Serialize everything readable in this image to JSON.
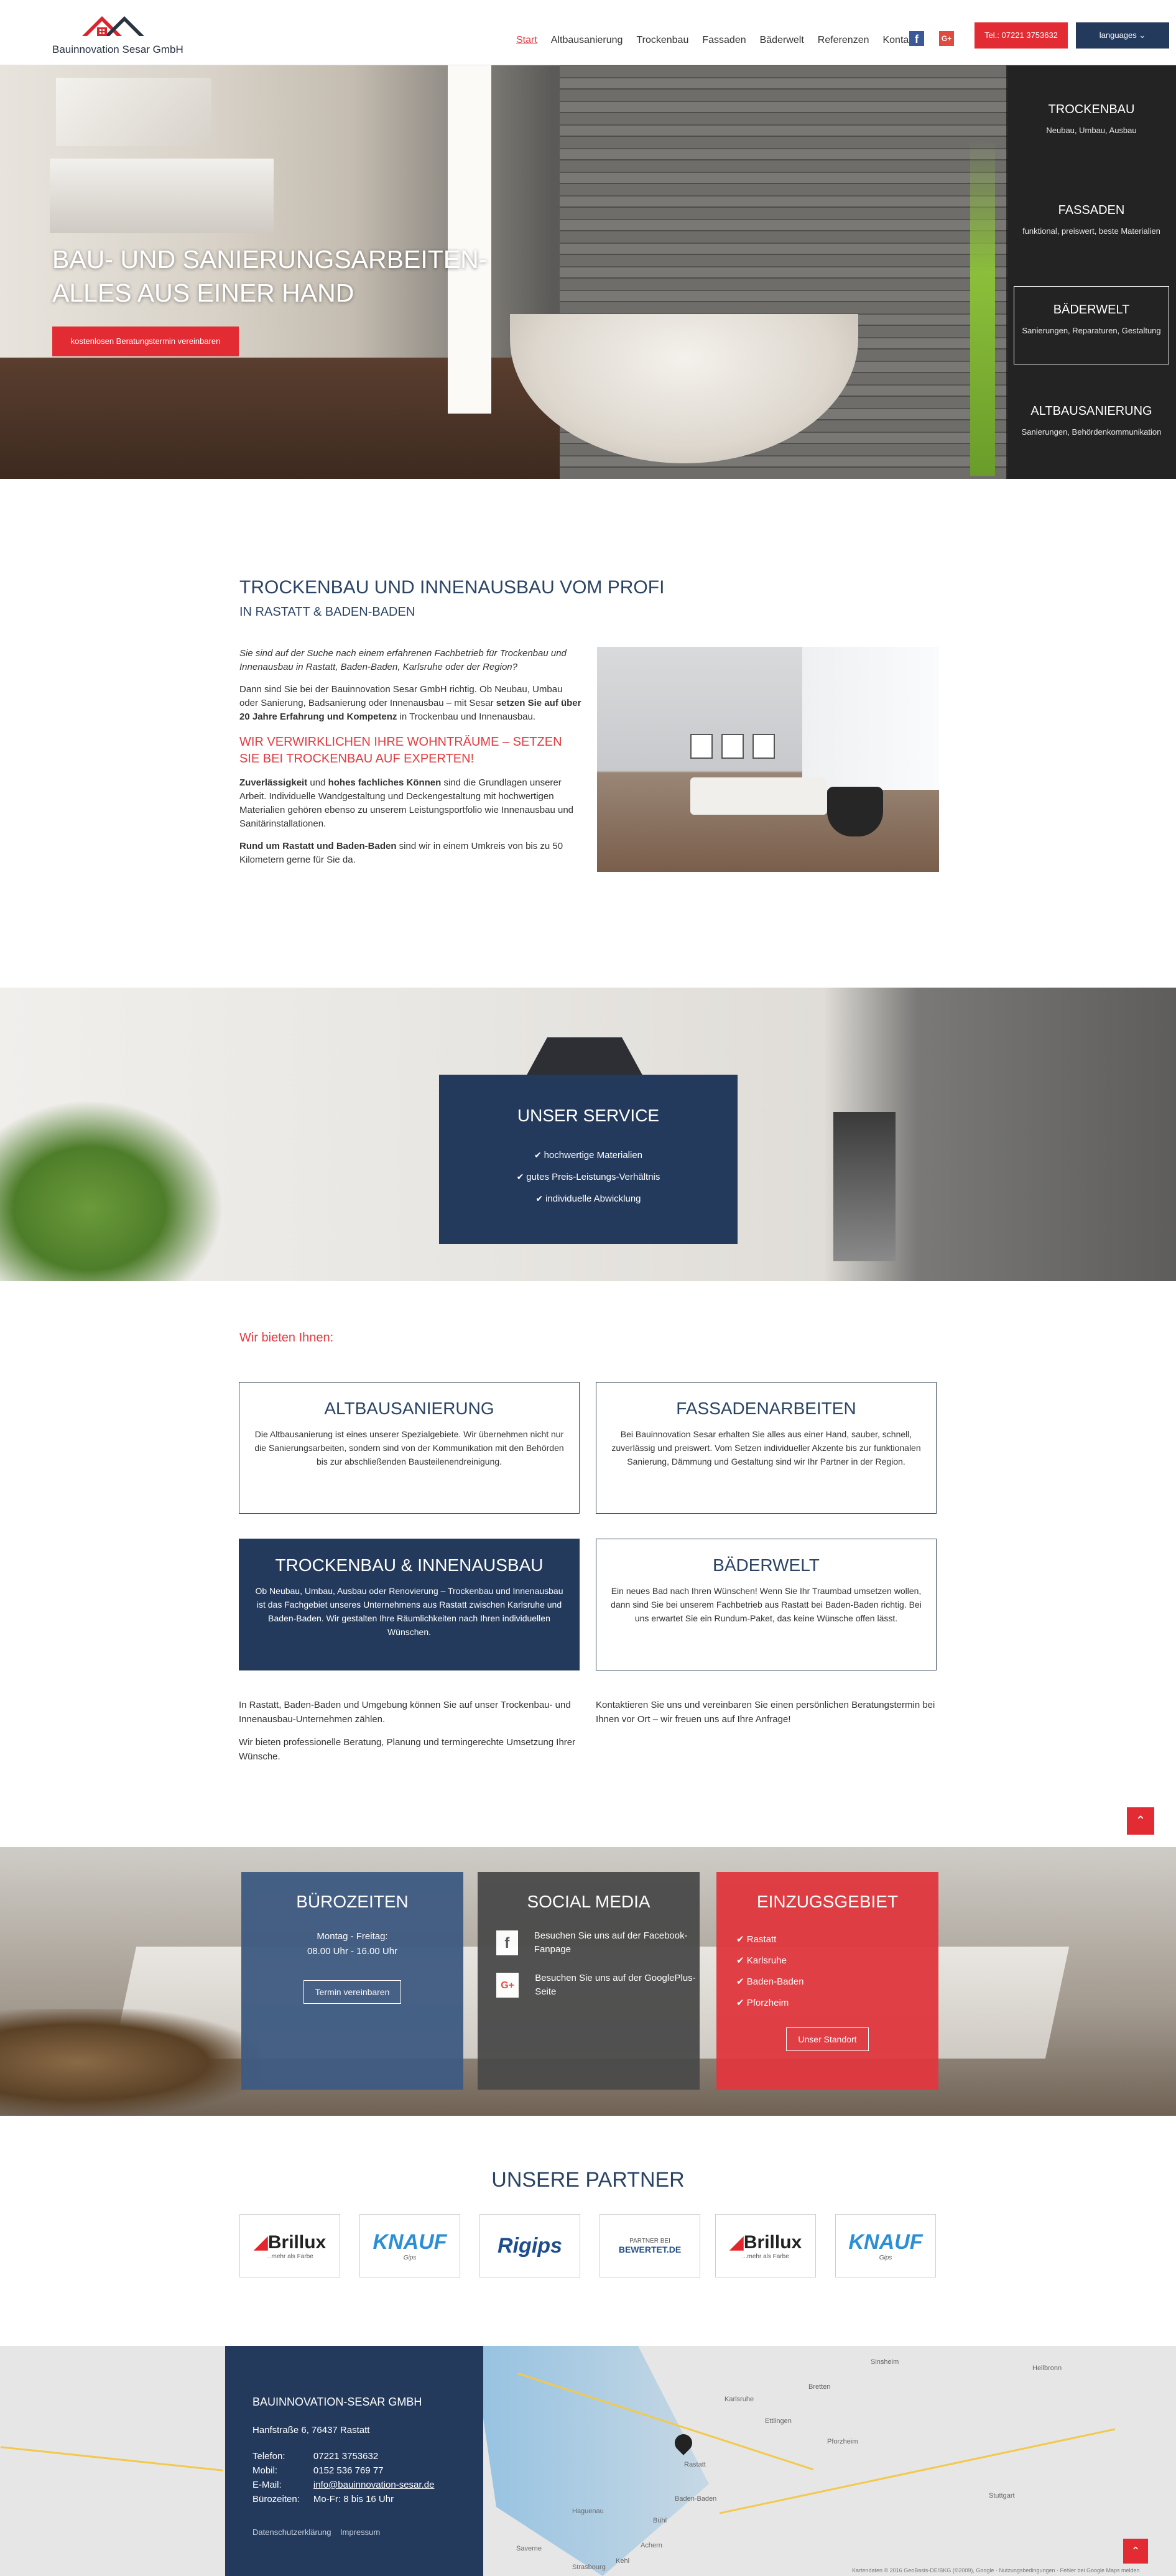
{
  "header": {
    "logo_text": "Bauinnovation Sesar GmbH",
    "nav": [
      "Start",
      "Altbausanierung",
      "Trockenbau",
      "Fassaden",
      "Bäderwelt",
      "Referenzen",
      "Kontakt"
    ],
    "phone_button": "Tel.: 07221 3753632",
    "language_button": "languages"
  },
  "hero": {
    "title_line1": "BAU- UND SANIERUNGSARBEITEN-",
    "title_line2": "ALLES AUS EINER HAND",
    "cta": "kostenlosen Beratungstermin vereinbaren"
  },
  "side_menu": [
    {
      "title": "TROCKENBAU",
      "desc": "Neubau, Umbau, Ausbau"
    },
    {
      "title": "FASSADEN",
      "desc": "funktional, preiswert, beste Materialien"
    },
    {
      "title": "BÄDERWELT",
      "desc": "Sanierungen, Reparaturen, Gestaltung"
    },
    {
      "title": "ALTBAUSANIERUNG",
      "desc": "Sanierungen, Behördenkommunikation"
    }
  ],
  "intro": {
    "heading": "TROCKENBAU UND INNENAUSBAU VOM PROFI",
    "subheading": "IN RASTATT & BADEN-BADEN",
    "p1": "Sie sind auf der Suche nach einem erfahrenen Fachbetrieb für Trockenbau und Innenausbau in Rastatt, Baden-Baden, Karlsruhe oder der Region?",
    "p2_a": "Dann sind Sie bei der Bauinnovation Sesar GmbH richtig. Ob Neubau, Umbau oder Sanierung, Badsanierung oder Innenausbau – mit Sesar ",
    "p2_b": "setzen Sie auf über 20 Jahre Erfahrung und Kompetenz",
    "p2_c": " in Trockenbau und Innenausbau.",
    "red_heading": "WIR VERWIRKLICHEN IHRE WOHNTRÄUME – SETZEN SIE BEI TROCKENBAU AUF EXPERTEN!",
    "p3_a": "Zuverlässigkeit",
    "p3_b": " und ",
    "p3_c": "hohes fachliches Können",
    "p3_d": " sind die Grundlagen unserer Arbeit. Individuelle Wandgestaltung und Deckengestaltung mit hochwertigen Materialien gehören ebenso zu unserem Leistungsportfolio wie Innenausbau und Sanitärinstallationen.",
    "p4_a": "Rund um Rastatt und Baden-Baden",
    "p4_b": " sind wir in einem Umkreis von bis zu 50 Kilometern gerne für Sie da."
  },
  "service": {
    "title": "UNSER SERVICE",
    "items": [
      "hochwertige Materialien",
      "gutes Preis-Leistungs-Verhältnis",
      "individuelle Abwicklung"
    ]
  },
  "offer": {
    "title": "Wir bieten Ihnen:",
    "cards": [
      {
        "title": "ALTBAUSANIERUNG",
        "text": "Die Altbausanierung ist eines unserer Spezialgebiete. Wir übernehmen nicht nur die Sanierungsarbeiten, sondern sind von der Kommunikation mit den Behörden bis zur abschließenden Bausteilenendreinigung."
      },
      {
        "title": "FASSADENARBEITEN",
        "text": "Bei Bauinnovation Sesar erhalten Sie alles aus einer Hand, sauber, schnell, zuverlässig und preiswert. Vom Setzen individueller Akzente bis zur funktionalen Sanierung, Dämmung und Gestaltung sind wir Ihr Partner in der Region."
      },
      {
        "title": "TROCKENBAU & INNENAUSBAU",
        "text": "Ob Neubau, Umbau, Ausbau oder Renovierung – Trockenbau und Innenausbau ist das Fachgebiet unseres Unternehmens aus Rastatt zwischen Karlsruhe und Baden-Baden. Wir gestalten Ihre Räumlichkeiten nach Ihren individuellen Wünschen."
      },
      {
        "title": "BÄDERWELT",
        "text": "Ein neues Bad nach Ihren Wünschen! Wenn Sie Ihr Traumbad umsetzen wollen, dann sind Sie bei unserem Fachbetrieb aus Rastatt bei Baden-Baden richtig. Bei uns erwartet Sie ein Rundum-Paket, das keine Wünsche offen lässt."
      }
    ],
    "note_left_1": "In Rastatt, Baden-Baden und Umgebung können Sie auf unser Trockenbau- und Innenausbau-Unternehmen zählen.",
    "note_left_2": "Wir bieten professionelle Beratung, Planung und termingerechte Umsetzung Ihrer Wünsche.",
    "note_right": "Kontaktieren Sie uns und vereinbaren Sie einen persönlichen Beratungstermin bei Ihnen vor Ort – wir freuen uns auf Ihre Anfrage!"
  },
  "info": {
    "hours_title": "BÜROZEITEN",
    "hours_days": "Montag - Freitag:",
    "hours_time": "08.00 Uhr - 16.00 Uhr",
    "hours_button": "Termin vereinbaren",
    "social_title": "SOCIAL MEDIA",
    "social_fb": "Besuchen Sie uns auf der Facebook-Fanpage",
    "social_gp": "Besuchen Sie uns auf der GooglePlus-Seite",
    "area_title": "EINZUGSGEBIET",
    "areas": [
      "Rastatt",
      "Karlsruhe",
      "Baden-Baden",
      "Pforzheim"
    ],
    "area_button": "Unser Standort",
    "colors": {
      "hours": "#3e5a82",
      "social": "#4a4a4a",
      "area": "#e0373e"
    }
  },
  "partners": {
    "title": "UNSERE PARTNER",
    "logos": [
      {
        "name": "Brillux",
        "sub": "...mehr als Farbe"
      },
      {
        "name": "KNAUF",
        "sub": "Gips"
      },
      {
        "name": "Rigips",
        "sub": ""
      },
      {
        "name": "BEWERTET.DE",
        "sub": "PARTNER BEI"
      },
      {
        "name": "Brillux",
        "sub": "...mehr als Farbe"
      },
      {
        "name": "KNAUF",
        "sub": "Gips"
      }
    ]
  },
  "contact": {
    "title": "BAUINNOVATION-SESAR GMBH",
    "address": "Hanfstraße 6, 76437 Rastatt",
    "rows": [
      {
        "label": "Telefon:",
        "value": "07221 3753632"
      },
      {
        "label": "Mobil:",
        "value": "0152 536 769 77"
      },
      {
        "label": "E-Mail:",
        "value": "info@bauinnovation-sesar.de"
      },
      {
        "label": "Bürozeiten:",
        "value": "Mo-Fr: 8 bis 16 Uhr"
      }
    ],
    "privacy": "Datenschutzerklärung",
    "imprint": "Impressum"
  },
  "map": {
    "cities": [
      "Haguenau",
      "Karlsruhe",
      "Rastatt",
      "Baden-Baden",
      "Pforzheim",
      "Stuttgart",
      "Heilbronn",
      "Bühl",
      "Achern",
      "Ettlingen",
      "Bretten",
      "Saverne",
      "Strasbourg",
      "Kehl",
      "Sinsheim"
    ],
    "footer": "Kartendaten © 2016 GeoBasis-DE/BKG (©2009), Google · Nutzungsbedingungen · Fehler bei Google Maps melden"
  }
}
